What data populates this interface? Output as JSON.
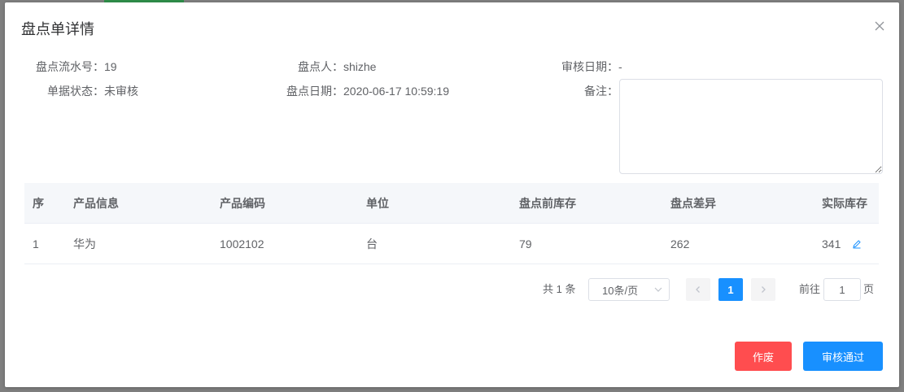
{
  "dialog": {
    "title": "盘点单详情"
  },
  "info": {
    "serial_label": "盘点流水号：",
    "serial_value": "19",
    "counter_label": "盘点人：",
    "counter_value": "shizhe",
    "audit_date_label": "审核日期：",
    "audit_date_value": "-",
    "status_label": "单据状态：",
    "status_value": "未审核",
    "count_date_label": "盘点日期：",
    "count_date_value": "2020-06-17 10:59:19",
    "remark_label": "备注：",
    "remark_value": ""
  },
  "table": {
    "columns": [
      "序",
      "产品信息",
      "产品编码",
      "单位",
      "盘点前库存",
      "盘点差异",
      "实际库存"
    ],
    "rows": [
      [
        "1",
        "华为",
        "1002102",
        "台",
        "79",
        "262",
        "341"
      ]
    ]
  },
  "pagination": {
    "total_text": "共 1 条",
    "page_size": "10条/页",
    "current_page": "1",
    "goto_label": "前往",
    "goto_value": "1",
    "goto_suffix": "页"
  },
  "buttons": {
    "void_label": "作废",
    "approve_label": "审核通过"
  },
  "colors": {
    "primary": "#1890ff",
    "danger": "#ff4d4f"
  },
  "icons": {
    "close": "close-icon",
    "edit": "edit-pencil-icon",
    "prev": "chevron-left-icon",
    "next": "chevron-right-icon",
    "select": "chevron-down-icon"
  }
}
